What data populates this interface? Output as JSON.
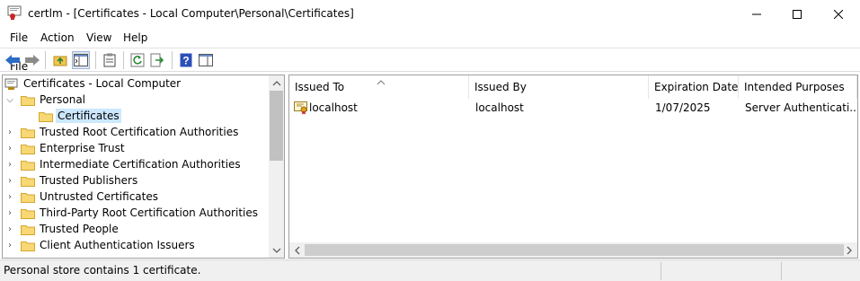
{
  "window": {
    "title": "certlm - [Certificates - Local Computer\\Personal\\Certificates]",
    "controls": [
      "minimize-icon",
      "maximize-icon",
      "close-icon"
    ]
  },
  "menu": [
    "File",
    "Action",
    "View",
    "Help"
  ],
  "toolbar": {
    "icons": [
      "back-arrow-icon",
      "forward-arrow-icon",
      "up-folder-icon",
      "show-hide-tree-icon",
      "clipboard-icon",
      "refresh-icon",
      "export-list-icon",
      "help-icon",
      "properties-pane-icon"
    ]
  },
  "tree": {
    "root": "Certificates - Local Computer",
    "items": [
      {
        "label": "Personal",
        "expanded": true
      },
      {
        "label": "Certificates",
        "selected": true,
        "child": true
      },
      {
        "label": "Trusted Root Certification Authorities"
      },
      {
        "label": "Enterprise Trust"
      },
      {
        "label": "Intermediate Certification Authorities"
      },
      {
        "label": "Trusted Publishers"
      },
      {
        "label": "Untrusted Certificates"
      },
      {
        "label": "Third-Party Root Certification Authorities"
      },
      {
        "label": "Trusted People"
      },
      {
        "label": "Client Authentication Issuers"
      }
    ]
  },
  "list": {
    "columns": [
      "Issued To",
      "Issued By",
      "Expiration Date",
      "Intended Purposes"
    ],
    "rows": [
      [
        "localhost",
        "localhost",
        "1/07/2025",
        "Server Authenticati..."
      ]
    ]
  },
  "status": {
    "text": "Personal store contains 1 certificate."
  },
  "colors": {
    "selection": "#cce8ff",
    "folder": "#f8d775",
    "accent": "#2b6cc4"
  }
}
